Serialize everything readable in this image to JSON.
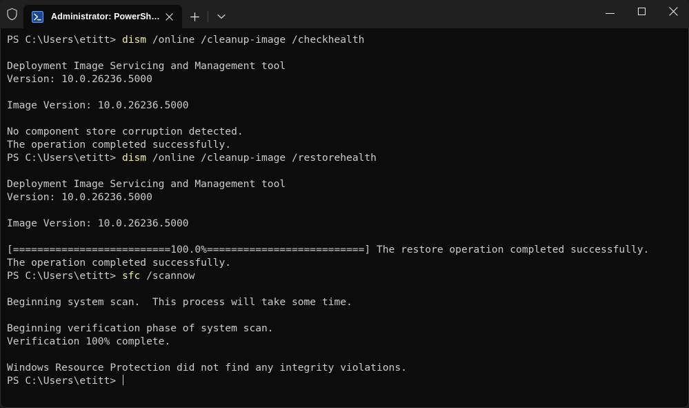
{
  "window": {
    "titlebar_color": "#202020",
    "terminal_bg": "#0c0c0c",
    "admin_shield_icon": "shield-icon",
    "tab": {
      "title": "Administrator: PowerShell",
      "icon": "powershell-icon",
      "close_icon": "close-icon"
    },
    "new_tab_icon": "plus-icon",
    "dropdown_icon": "chevron-down-icon",
    "caption": {
      "minimize_icon": "minimize-icon",
      "maximize_icon": "maximize-icon",
      "close_icon": "close-icon"
    }
  },
  "terminal": {
    "prompt": "PS C:\\Users\\etitt>",
    "command_color": "#f2efa3",
    "text_color": "#cccccc",
    "lines": [
      {
        "type": "prompt",
        "prompt": "PS C:\\Users\\etitt> ",
        "command": "dism",
        "args": " /online /cleanup-image /checkhealth"
      },
      {
        "type": "blank",
        "text": ""
      },
      {
        "type": "out",
        "text": "Deployment Image Servicing and Management tool"
      },
      {
        "type": "out",
        "text": "Version: 10.0.26236.5000"
      },
      {
        "type": "blank",
        "text": ""
      },
      {
        "type": "out",
        "text": "Image Version: 10.0.26236.5000"
      },
      {
        "type": "blank",
        "text": ""
      },
      {
        "type": "out",
        "text": "No component store corruption detected."
      },
      {
        "type": "out",
        "text": "The operation completed successfully."
      },
      {
        "type": "prompt",
        "prompt": "PS C:\\Users\\etitt> ",
        "command": "dism",
        "args": " /online /cleanup-image /restorehealth"
      },
      {
        "type": "blank",
        "text": ""
      },
      {
        "type": "out",
        "text": "Deployment Image Servicing and Management tool"
      },
      {
        "type": "out",
        "text": "Version: 10.0.26236.5000"
      },
      {
        "type": "blank",
        "text": ""
      },
      {
        "type": "out",
        "text": "Image Version: 10.0.26236.5000"
      },
      {
        "type": "blank",
        "text": ""
      },
      {
        "type": "out",
        "text": "[==========================100.0%==========================] The restore operation completed successfully."
      },
      {
        "type": "out",
        "text": "The operation completed successfully."
      },
      {
        "type": "prompt",
        "prompt": "PS C:\\Users\\etitt> ",
        "command": "sfc",
        "args": " /scannow"
      },
      {
        "type": "blank",
        "text": ""
      },
      {
        "type": "out",
        "text": "Beginning system scan.  This process will take some time."
      },
      {
        "type": "blank",
        "text": ""
      },
      {
        "type": "out",
        "text": "Beginning verification phase of system scan."
      },
      {
        "type": "out",
        "text": "Verification 100% complete."
      },
      {
        "type": "blank",
        "text": ""
      },
      {
        "type": "out",
        "text": "Windows Resource Protection did not find any integrity violations."
      },
      {
        "type": "cursor",
        "prompt": "PS C:\\Users\\etitt> ",
        "command": "",
        "args": ""
      }
    ]
  }
}
